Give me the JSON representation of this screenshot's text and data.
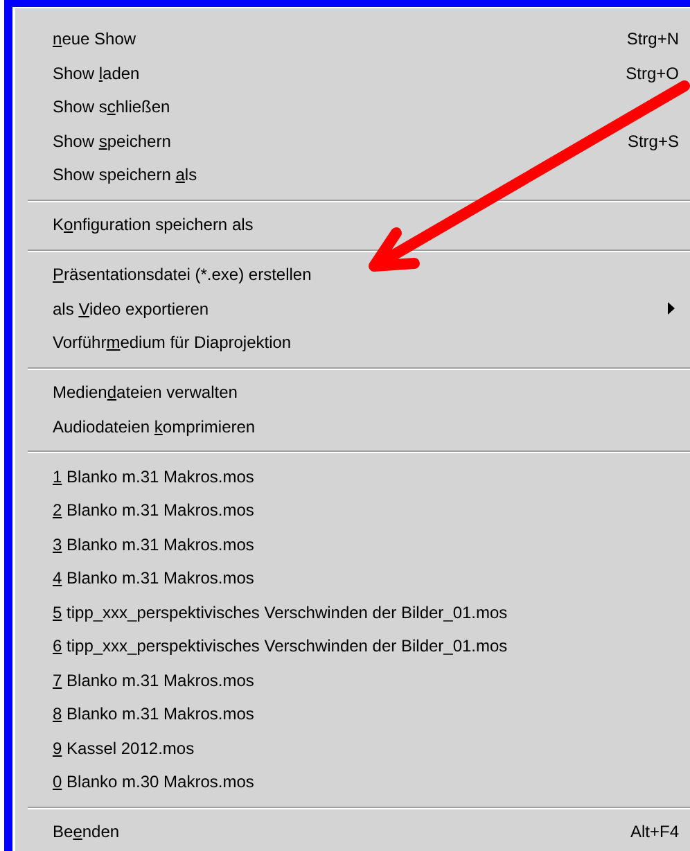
{
  "menu": {
    "sections": [
      {
        "items": [
          {
            "key": "n",
            "after": "eue Show",
            "shortcut": "Strg+N",
            "submenu": false
          },
          {
            "before": "Show ",
            "key": "l",
            "after": "aden",
            "shortcut": "Strg+O",
            "submenu": false
          },
          {
            "before": "Show s",
            "key": "c",
            "after": "hließen",
            "submenu": false
          },
          {
            "before": "Show ",
            "key": "s",
            "after": "peichern",
            "shortcut": "Strg+S",
            "submenu": false
          },
          {
            "before": "Show speichern ",
            "key": "a",
            "after": "ls",
            "submenu": false
          }
        ]
      },
      {
        "items": [
          {
            "before": "K",
            "key": "o",
            "after": "nfiguration speichern als",
            "submenu": false
          }
        ]
      },
      {
        "items": [
          {
            "key": "P",
            "after": "räsentationsdatei (*.exe) erstellen",
            "submenu": false
          },
          {
            "before": "als ",
            "key": "V",
            "after": "ideo exportieren",
            "submenu": true
          },
          {
            "before": "Vorführ",
            "key": "m",
            "after": "edium für Diaprojektion",
            "submenu": false
          }
        ]
      },
      {
        "items": [
          {
            "before": "Medien",
            "key": "d",
            "after": "ateien verwalten",
            "submenu": false
          },
          {
            "before": "Audiodateien ",
            "key": "k",
            "after": "omprimieren",
            "submenu": false
          }
        ]
      },
      {
        "items": [
          {
            "key": "1",
            "after": " Blanko m.31 Makros.mos",
            "submenu": false
          },
          {
            "key": "2",
            "after": " Blanko m.31 Makros.mos",
            "submenu": false
          },
          {
            "key": "3",
            "after": " Blanko m.31 Makros.mos",
            "submenu": false
          },
          {
            "key": "4",
            "after": " Blanko m.31 Makros.mos",
            "submenu": false
          },
          {
            "key": "5",
            "after": " tipp_xxx_perspektivisches Verschwinden der Bilder_01.mos",
            "submenu": false
          },
          {
            "key": "6",
            "after": " tipp_xxx_perspektivisches Verschwinden der Bilder_01.mos",
            "submenu": false
          },
          {
            "key": "7",
            "after": " Blanko m.31 Makros.mos",
            "submenu": false
          },
          {
            "key": "8",
            "after": " Blanko m.31 Makros.mos",
            "submenu": false
          },
          {
            "key": "9",
            "after": " Kassel 2012.mos",
            "submenu": false
          },
          {
            "key": "0",
            "after": " Blanko m.30 Makros.mos",
            "submenu": false
          }
        ]
      },
      {
        "items": [
          {
            "before": "Be",
            "key": "e",
            "after": "nden",
            "shortcut": "Alt+F4",
            "submenu": false
          }
        ]
      }
    ]
  }
}
